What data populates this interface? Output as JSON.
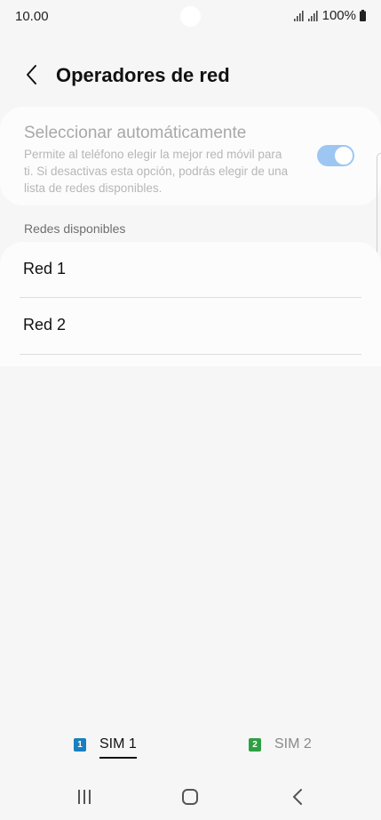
{
  "status_bar": {
    "time": "10.00",
    "battery": "100%"
  },
  "header": {
    "title": "Operadores de red",
    "back_icon": "chevron-left-icon"
  },
  "auto_select": {
    "title": "Seleccionar automáticamente",
    "description": "Permite al teléfono elegir la mejor red móvil para ti. Si desactivas esta opción, podrás elegir de una lista de redes disponibles.",
    "toggle_on": true,
    "toggle_color": "#9dc6f2"
  },
  "networks": {
    "section_label": "Redes disponibles",
    "items": [
      {
        "label": "Red 1"
      },
      {
        "label": "Red 2"
      }
    ]
  },
  "sim_tabs": [
    {
      "badge": "1",
      "label": "SIM 1",
      "color": "#1a7fbf",
      "active": true
    },
    {
      "badge": "2",
      "label": "SIM 2",
      "color": "#2ea043",
      "active": false
    }
  ],
  "nav_bar": {
    "icons": [
      "recents-icon",
      "home-icon",
      "back-icon"
    ]
  }
}
